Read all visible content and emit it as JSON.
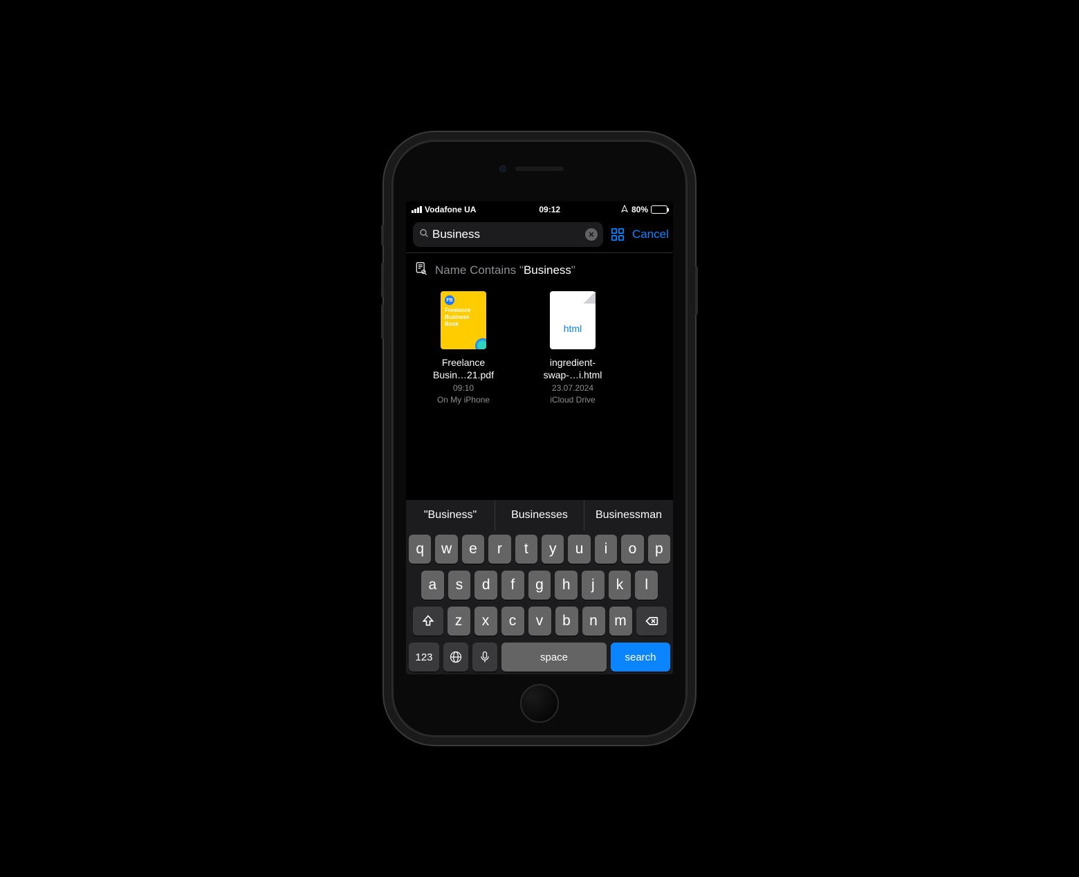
{
  "status": {
    "carrier": "Vodafone UA",
    "time": "09:12",
    "battery_pct": "80%"
  },
  "search": {
    "value": "Business",
    "cancel": "Cancel"
  },
  "scope": {
    "prefix": "Name Contains \"",
    "term": "Business",
    "suffix": "\""
  },
  "files": [
    {
      "name_line1": "Freelance",
      "name_line2": "Busin…21.pdf",
      "time": "09:10",
      "location": "On My iPhone",
      "cover_badge": "FB",
      "cover_title": "Freelance\nBusiness\nBook"
    },
    {
      "name_line1": "ingredient-",
      "name_line2": "swap-…i.html",
      "time": "23.07.2024",
      "location": "iCloud Drive",
      "ext_label": "html"
    }
  ],
  "suggestions": [
    "\"Business\"",
    "Businesses",
    "Businessman"
  ],
  "keyboard": {
    "row1": [
      "q",
      "w",
      "e",
      "r",
      "t",
      "y",
      "u",
      "i",
      "o",
      "p"
    ],
    "row2": [
      "a",
      "s",
      "d",
      "f",
      "g",
      "h",
      "j",
      "k",
      "l"
    ],
    "row3": [
      "z",
      "x",
      "c",
      "v",
      "b",
      "n",
      "m"
    ],
    "num": "123",
    "space": "space",
    "search": "search"
  }
}
